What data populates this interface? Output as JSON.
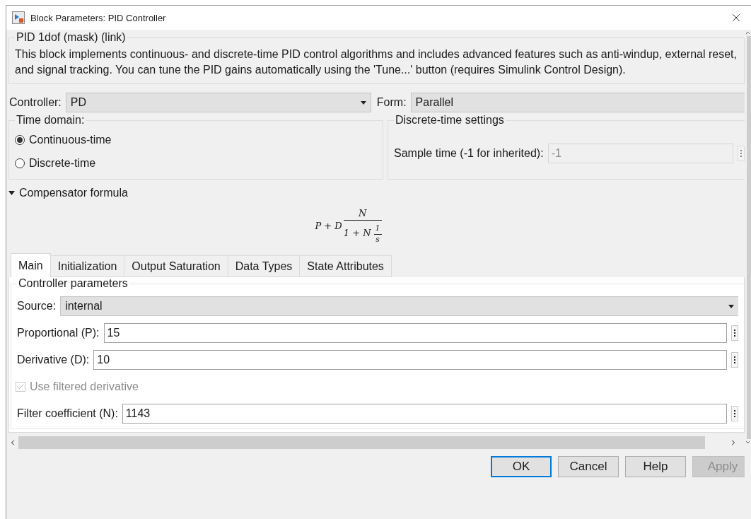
{
  "window": {
    "title": "Block Parameters: PID Controller"
  },
  "mask": {
    "title": "PID 1dof (mask) (link)",
    "description": "This block implements continuous- and discrete-time PID control algorithms and includes advanced features such as anti-windup, external reset, and signal tracking. You can tune the PID gains automatically using the 'Tune...' button (requires Simulink Control Design)."
  },
  "controller": {
    "label": "Controller:",
    "value": "PD"
  },
  "form": {
    "label": "Form:",
    "value": "Parallel"
  },
  "time_domain": {
    "title": "Time domain:",
    "options": [
      {
        "label": "Continuous-time",
        "selected": true
      },
      {
        "label": "Discrete-time",
        "selected": false
      }
    ]
  },
  "discrete_settings": {
    "title": "Discrete-time settings",
    "sample_time": {
      "label": "Sample time (-1 for inherited):",
      "value": "-1",
      "disabled": true
    }
  },
  "compensator": {
    "label": "Compensator formula",
    "expanded": true,
    "formula": {
      "lead": "P + D",
      "numerator": "N",
      "denominator": "1 + N",
      "inner_numerator": "1",
      "inner_denominator": "s"
    }
  },
  "tabs": [
    {
      "label": "Main",
      "selected": true
    },
    {
      "label": "Initialization",
      "selected": false
    },
    {
      "label": "Output Saturation",
      "selected": false
    },
    {
      "label": "Data Types",
      "selected": false
    },
    {
      "label": "State Attributes",
      "selected": false
    }
  ],
  "controller_parameters": {
    "title": "Controller parameters",
    "source": {
      "label": "Source:",
      "value": "internal"
    },
    "fields": [
      {
        "kind": "text",
        "label": "Proportional (P):",
        "value": "15"
      },
      {
        "kind": "text",
        "label": "Derivative (D):",
        "value": "10"
      },
      {
        "kind": "checkbox",
        "label": "Use filtered derivative",
        "checked": true,
        "disabled": true
      },
      {
        "kind": "text",
        "label": "Filter coefficient (N):",
        "value": "1143"
      }
    ]
  },
  "buttons": [
    {
      "label": "OK",
      "default": true,
      "disabled": false
    },
    {
      "label": "Cancel",
      "default": false,
      "disabled": false
    },
    {
      "label": "Help",
      "default": false,
      "disabled": false
    },
    {
      "label": "Apply",
      "default": false,
      "disabled": true
    }
  ]
}
